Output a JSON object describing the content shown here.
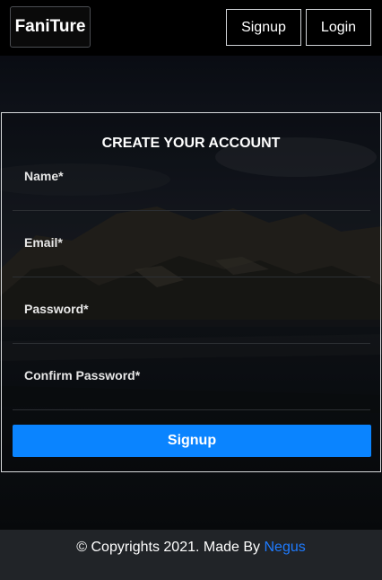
{
  "navbar": {
    "brand": "FaniTure",
    "signup_label": "Signup",
    "login_label": "Login"
  },
  "form": {
    "title": "CREATE YOUR ACCOUNT",
    "fields": [
      {
        "label": "Name*",
        "value": "",
        "type": "text"
      },
      {
        "label": "Email*",
        "value": "",
        "type": "email"
      },
      {
        "label": "Password*",
        "value": "",
        "type": "password"
      },
      {
        "label": "Confirm Password*",
        "value": "",
        "type": "password"
      }
    ],
    "submit_label": "Signup"
  },
  "footer": {
    "text": "© Copyrights 2021. Made By",
    "link_text": "Negus"
  },
  "colors": {
    "accent": "#0a84ff",
    "footer_link": "#1e7bff",
    "footer_bg": "#212428",
    "navbar_bg": "#000000"
  }
}
